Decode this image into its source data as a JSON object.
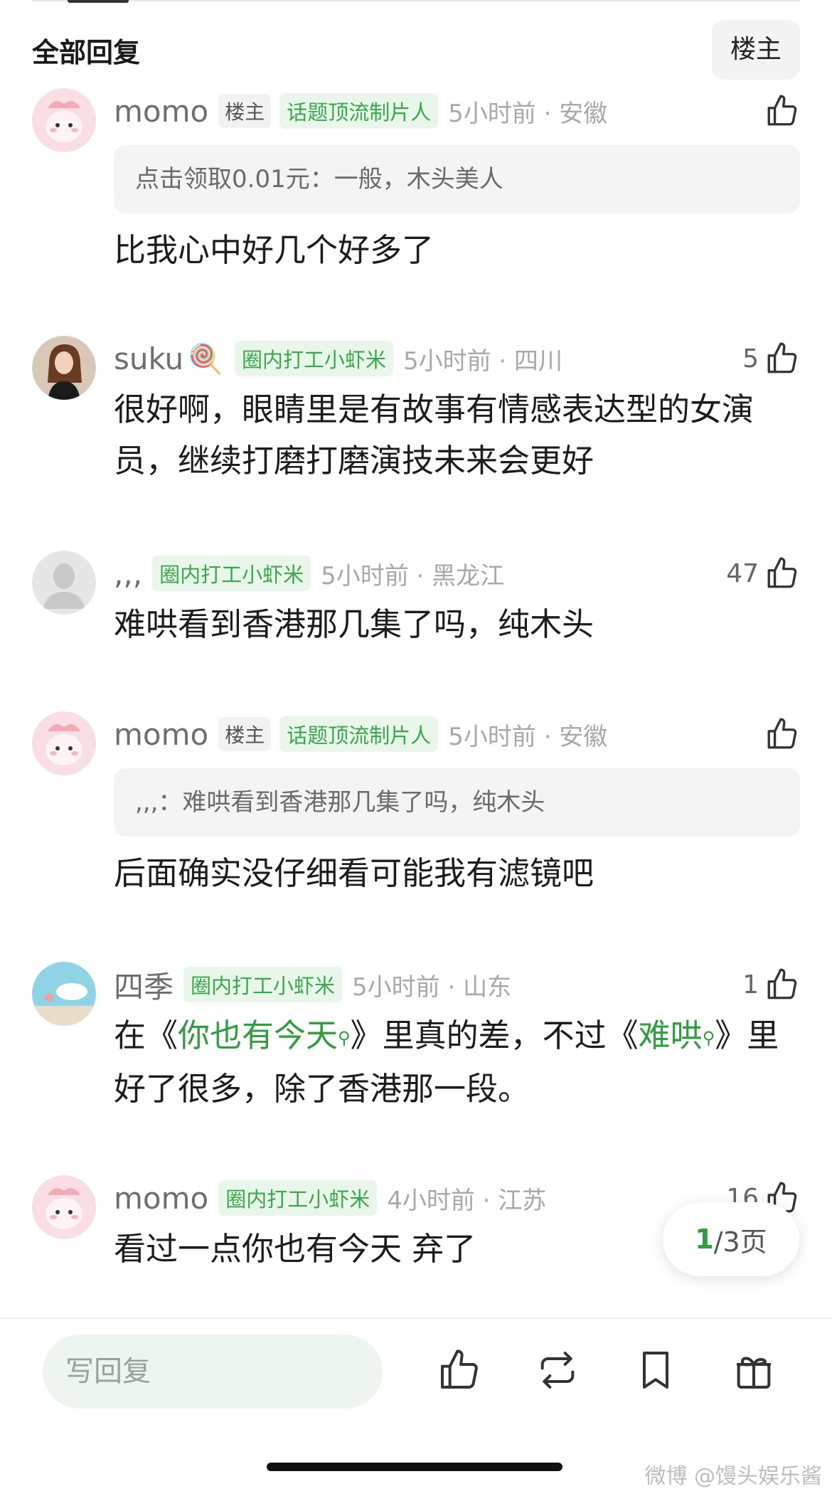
{
  "header": {
    "title": "全部回复",
    "filter_label": "楼主"
  },
  "comments": [
    {
      "username": "momo",
      "owner_badge": "楼主",
      "tag": "话题顶流制片人",
      "time": "5小时前 · 安徽",
      "likes": "",
      "quote": "点击领取0.01元：一般，木头美人",
      "text": "比我心中好几个好多了"
    },
    {
      "username": "suku",
      "emoji": "🍭",
      "tag": "圈内打工小虾米",
      "time": "5小时前 · 四川",
      "likes": "5",
      "text": "很好啊，眼睛里是有故事有情感表达型的女演员，继续打磨打磨演技未来会更好"
    },
    {
      "username": ",,,",
      "tag": "圈内打工小虾米",
      "time": "5小时前 · 黑龙江",
      "likes": "47",
      "text": "难哄看到香港那几集了吗，纯木头"
    },
    {
      "username": "momo",
      "owner_badge": "楼主",
      "tag": "话题顶流制片人",
      "time": "5小时前 · 安徽",
      "likes": "",
      "quote": ",,,：难哄看到香港那几集了吗，纯木头",
      "text": "后面确实没仔细看可能我有滤镜吧"
    },
    {
      "username": "四季",
      "tag": "圈内打工小虾米",
      "time": "5小时前 · 山东",
      "likes": "1",
      "text_parts": {
        "p1": "在《",
        "link1": "你也有今天",
        "p2": "》里真的差，不过《",
        "link2": "难哄",
        "p3": "》里好了很多，除了香港那一段。"
      }
    },
    {
      "username": "momo",
      "tag": "圈内打工小虾米",
      "time": "4小时前 · 江苏",
      "likes": "16",
      "text": "看过一点你也有今天 弃了"
    }
  ],
  "pagination": {
    "current": "1",
    "rest": "/3页"
  },
  "bottom_bar": {
    "reply_placeholder": "写回复"
  },
  "watermark": "微博 @馒头娱乐酱",
  "colors": {
    "accent_green": "#2e9e3f",
    "tag_bg": "#e9f6ea",
    "quote_bg": "#f4f4f4"
  },
  "icons": [
    "thumbs-up-icon",
    "search-icon",
    "repost-icon",
    "bookmark-icon",
    "gift-icon",
    "weibo-logo-icon"
  ]
}
